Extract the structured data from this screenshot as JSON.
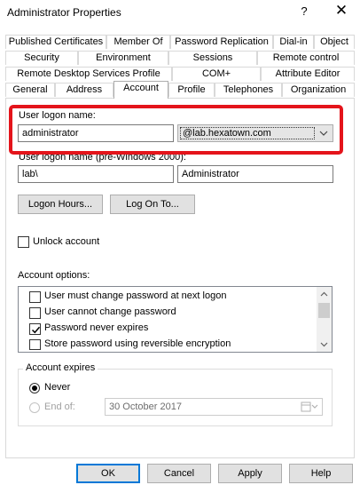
{
  "window": {
    "title": "Administrator Properties",
    "help_glyph": "?",
    "close_glyph": "✕"
  },
  "tabs": {
    "row1": [
      "Published Certificates",
      "Member Of",
      "Password Replication",
      "Dial-in",
      "Object"
    ],
    "row2": [
      "Security",
      "Environment",
      "Sessions",
      "Remote control"
    ],
    "row3": [
      "Remote Desktop Services Profile",
      "COM+",
      "Attribute Editor"
    ],
    "row4": [
      "General",
      "Address",
      "Account",
      "Profile",
      "Telephones",
      "Organization"
    ],
    "active": "Account"
  },
  "account": {
    "logon_name_label": "User logon name:",
    "logon_name_value": "administrator",
    "upn_suffix": "@lab.hexatown.com",
    "pre2000_label": "User logon name (pre-Windows 2000):",
    "domain_prefix": "lab\\",
    "sam_name": "Administrator",
    "logon_hours_button": "Logon Hours...",
    "logon_to_button": "Log On To...",
    "unlock_label": "Unlock account",
    "unlock_checked": false,
    "options_label": "Account options:",
    "options": [
      {
        "label": "User must change password at next logon",
        "checked": false
      },
      {
        "label": "User cannot change password",
        "checked": false
      },
      {
        "label": "Password never expires",
        "checked": true
      },
      {
        "label": "Store password using reversible encryption",
        "checked": false
      }
    ],
    "expires_group": "Account expires",
    "never_label": "Never",
    "never_selected": true,
    "end_of_label": "End of:",
    "end_date": "30  October  2017"
  },
  "footer": {
    "ok": "OK",
    "cancel": "Cancel",
    "apply": "Apply",
    "help": "Help"
  },
  "colors": {
    "highlight": "#e4141b",
    "focus_border": "#0078d7"
  }
}
